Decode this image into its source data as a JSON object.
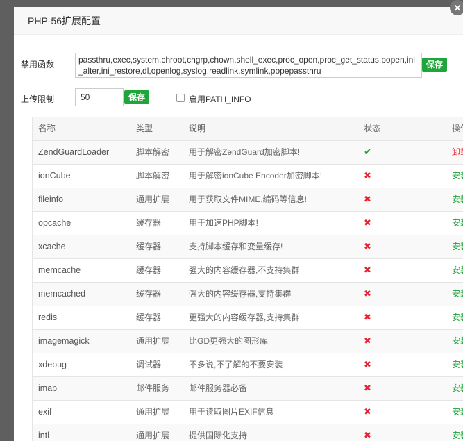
{
  "dialog": {
    "title": "PHP-56扩展配置",
    "close_icon": "×"
  },
  "disable_functions": {
    "label": "禁用函数",
    "value": "passthru,exec,system,chroot,chgrp,chown,shell_exec,proc_open,proc_get_status,popen,ini_alter,ini_restore,dl,openlog,syslog,readlink,symlink,popepassthru",
    "save_label": "保存"
  },
  "upload_limit": {
    "label": "上传限制",
    "value": "50",
    "save_label": "保存"
  },
  "path_info": {
    "label": "启用PATH_INFO",
    "checked": false
  },
  "table": {
    "headers": {
      "name": "名称",
      "type": "类型",
      "desc": "说明",
      "status": "状态",
      "action": "操作"
    },
    "rows": [
      {
        "name": "ZendGuardLoader",
        "type": "脚本解密",
        "desc": "用于解密ZendGuard加密脚本!",
        "status": "✔",
        "action": "卸载"
      },
      {
        "name": "ionCube",
        "type": "脚本解密",
        "desc": "用于解密ionCube Encoder加密脚本!",
        "status": "✖",
        "action": "安装"
      },
      {
        "name": "fileinfo",
        "type": "通用扩展",
        "desc": "用于获取文件MIME,编码等信息!",
        "status": "✖",
        "action": "安装"
      },
      {
        "name": "opcache",
        "type": "缓存器",
        "desc": "用于加速PHP脚本!",
        "status": "✖",
        "action": "安装"
      },
      {
        "name": "xcache",
        "type": "缓存器",
        "desc": "支持脚本缓存和变量缓存!",
        "status": "✖",
        "action": "安装"
      },
      {
        "name": "memcache",
        "type": "缓存器",
        "desc": "强大的内容缓存器,不支持集群",
        "status": "✖",
        "action": "安装"
      },
      {
        "name": "memcached",
        "type": "缓存器",
        "desc": "强大的内容缓存器,支持集群",
        "status": "✖",
        "action": "安装"
      },
      {
        "name": "redis",
        "type": "缓存器",
        "desc": "更强大的内容缓存器,支持集群",
        "status": "✖",
        "action": "安装"
      },
      {
        "name": "imagemagick",
        "type": "通用扩展",
        "desc": "比GD更强大的图形库",
        "status": "✖",
        "action": "安装"
      },
      {
        "name": "xdebug",
        "type": "调试器",
        "desc": "不多说,不了解的不要安装",
        "status": "✖",
        "action": "安装"
      },
      {
        "name": "imap",
        "type": "邮件服务",
        "desc": "邮件服务器必备",
        "status": "✖",
        "action": "安装"
      },
      {
        "name": "exif",
        "type": "通用扩展",
        "desc": "用于读取图片EXIF信息",
        "status": "✖",
        "action": "安装"
      },
      {
        "name": "intl",
        "type": "通用扩展",
        "desc": "提供国际化支持",
        "status": "✖",
        "action": "安装"
      }
    ]
  },
  "colors": {
    "accent_green": "#20a53a",
    "danger_red": "#e8232e"
  }
}
